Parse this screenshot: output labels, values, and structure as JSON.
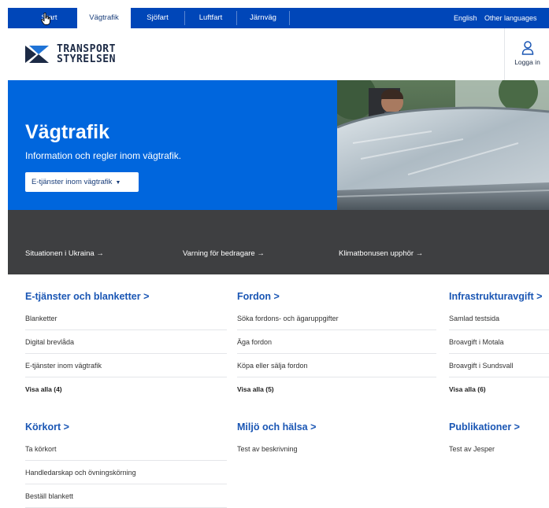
{
  "topnav": {
    "tabs": [
      "Start",
      "Vägtrafik",
      "Sjöfart",
      "Luftfart",
      "Järnväg"
    ],
    "active_tab": "Vägtrafik",
    "english": "English",
    "other_languages": "Other languages"
  },
  "header": {
    "logo_line1": "TRANSPORT",
    "logo_line2": "STYRELSEN",
    "login_label": "Logga in"
  },
  "hero": {
    "title": "Vägtrafik",
    "subtitle": "Information och regler inom vägtrafik.",
    "dropdown_label": "E-tjänster inom vägtrafik"
  },
  "banner": {
    "links": [
      "Situationen i Ukraina",
      "Varning för bedragare",
      "Klimatbonusen upphör"
    ],
    "arrow": "→"
  },
  "sections": {
    "etjanster": {
      "title": "E-tjänster och blanketter",
      "items": [
        "Blanketter",
        "Digital brevlåda",
        "E-tjänster inom vägtrafik"
      ],
      "more": "Visa alla (4)"
    },
    "fordon": {
      "title": "Fordon",
      "items": [
        "Söka fordons- och ägaruppgifter",
        "Äga fordon",
        "Köpa eller sälja fordon"
      ],
      "more": "Visa alla (5)"
    },
    "infra": {
      "title": "Infrastrukturavgift",
      "items": [
        "Samlad testsida",
        "Broavgift i Motala",
        "Broavgift i Sundsvall"
      ],
      "more": "Visa alla (6)"
    },
    "korkort": {
      "title": "Körkort",
      "items": [
        "Ta körkort",
        "Handledarskap och övningskörning",
        "Beställ blankett"
      ]
    },
    "miljo": {
      "title": "Miljö och hälsa",
      "items": [
        "Test av beskrivning"
      ]
    },
    "publikationer": {
      "title": "Publikationer",
      "items": [
        "Test av Jesper"
      ]
    },
    "chevron": ">"
  },
  "colors": {
    "nav_blue": "#0046b8",
    "hero_blue": "#0066dd",
    "strip_gray": "#3e3f41",
    "link_blue": "#1a56b4"
  }
}
